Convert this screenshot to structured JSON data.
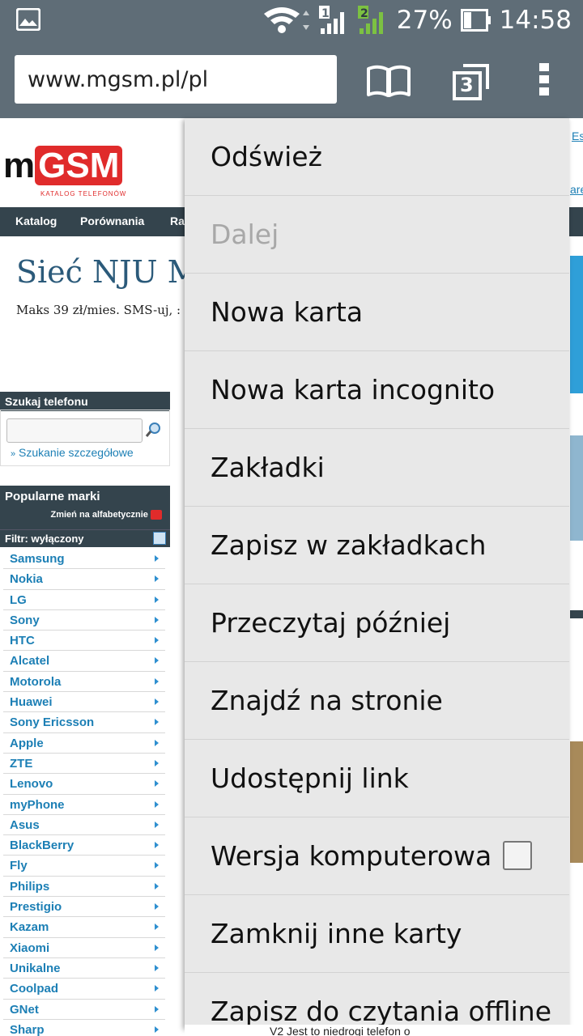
{
  "status": {
    "battery": "27%",
    "time": "14:58",
    "sim1": "1",
    "sim2": "2"
  },
  "toolbar": {
    "url": "www.mgsm.pl/pl",
    "tabs_count": "3"
  },
  "site": {
    "logo_text": "mGSM",
    "logo_tagline": "KATALOG TELEFONÓW",
    "nav": [
      "Katalog",
      "Porównania",
      "Ra"
    ],
    "headline": "Sieć NJU M",
    "subline": "Maks 39 zł/mies. SMS-uj, :",
    "search_title": "Szukaj telefonu",
    "advanced_search": "Szukanie szczegółowe",
    "popular_title": "Popularne marki",
    "sort_alpha": "Zmień na alfabetycznie",
    "filter": "Filtr: wyłączony",
    "brands": [
      "Samsung",
      "Nokia",
      "LG",
      "Sony",
      "HTC",
      "Alcatel",
      "Motorola",
      "Huawei",
      "Sony Ericsson",
      "Apple",
      "ZTE",
      "Lenovo",
      "myPhone",
      "Asus",
      "BlackBerry",
      "Fly",
      "Philips",
      "Prestigio",
      "Kazam",
      "Xiaomi",
      "Unikalne",
      "Coolpad",
      "GNet",
      "Sharp"
    ],
    "bottom_text": "V2   Jest to niedrogi telefon o"
  },
  "menu": {
    "items": [
      {
        "label": "Odśwież",
        "enabled": true
      },
      {
        "label": "Dalej",
        "enabled": false
      },
      {
        "label": "Nowa karta",
        "enabled": true
      },
      {
        "label": "Nowa karta incognito",
        "enabled": true
      },
      {
        "label": "Zakładki",
        "enabled": true
      },
      {
        "label": "Zapisz w zakładkach",
        "enabled": true
      },
      {
        "label": "Przeczytaj później",
        "enabled": true
      },
      {
        "label": "Znajdź na stronie",
        "enabled": true
      },
      {
        "label": "Udostępnij link",
        "enabled": true
      },
      {
        "label": "Wersja komputerowa",
        "enabled": true,
        "checked": false
      },
      {
        "label": "Zamknij inne karty",
        "enabled": true
      },
      {
        "label": "Zapisz do czytania offline",
        "enabled": true
      }
    ]
  },
  "colors": {
    "toolbar": "#5f6d77",
    "menu_bg": "#e8e8e8",
    "link": "#1c7fb5",
    "site_dark": "#34444d",
    "logo_red": "#e02b2b"
  }
}
